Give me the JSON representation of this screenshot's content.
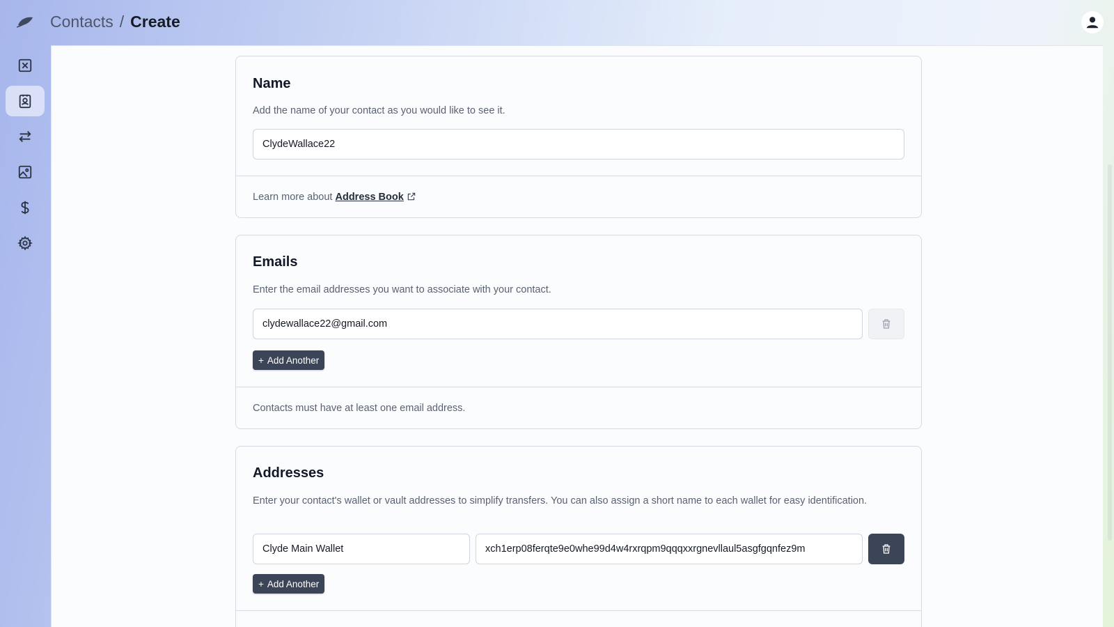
{
  "breadcrumb": {
    "parent": "Contacts",
    "separator": "/",
    "current": "Create"
  },
  "sidebar": {
    "items": [
      {
        "icon": "x-square-icon",
        "active": false
      },
      {
        "icon": "contact-card-icon",
        "active": true
      },
      {
        "icon": "transfer-arrows-icon",
        "active": false
      },
      {
        "icon": "image-icon",
        "active": false
      },
      {
        "icon": "dollar-icon",
        "active": false
      },
      {
        "icon": "gear-icon",
        "active": false
      }
    ]
  },
  "name_section": {
    "title": "Name",
    "description": "Add the name of your contact as you would like to see it.",
    "name_value": "ClydeWallace22",
    "learn_prefix": "Learn more about",
    "learn_link": "Address Book"
  },
  "emails_section": {
    "title": "Emails",
    "description": "Enter the email addresses you want to associate with your contact.",
    "email_value": "clydewallace22@gmail.com",
    "add_label": "Add Another",
    "footer": "Contacts must have at least one email address."
  },
  "addresses_section": {
    "title": "Addresses",
    "description": "Enter your contact's wallet or vault addresses to simplify transfers. You can also assign a short name to each wallet for easy identification.",
    "wallet_name_value": "Clyde Main Wallet",
    "wallet_address_value": "xch1erp08ferqte9e0whe99d4w4rxrqpm9qqqxxrgnevllaul5asgfgqnfez9m",
    "add_label": "Add Another"
  },
  "colors": {
    "accent_dark": "#3c4557",
    "card_border": "#d6dbe3"
  }
}
